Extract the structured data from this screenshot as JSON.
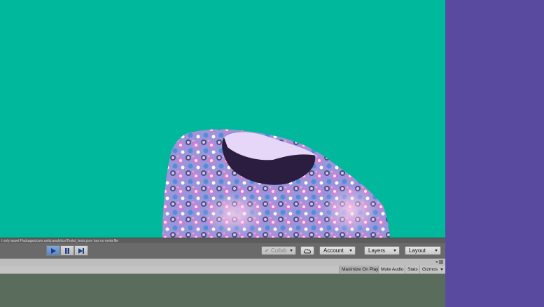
{
  "console": {
    "message": "t only asset Packages/com.unity.analytics/Tests/_tests.json has no meta file"
  },
  "toolbar": {
    "play_icon": "play-icon",
    "pause_icon": "pause-icon",
    "step_icon": "step-icon",
    "collab_label": "Collab",
    "account_label": "Account",
    "layers_label": "Layers",
    "layout_label": "Layout"
  },
  "game_options": {
    "maximize_on_play": "Maximize On Play",
    "mute_audio": "Mute Audio",
    "stats": "Stats",
    "gizmos": "Gizmos"
  },
  "colors": {
    "scene_background": "#00b89c",
    "side_panel": "#5a4a9f",
    "toolbar": "#6a6a6a",
    "play_active": "#5b86c0",
    "game_view": "#5a6d5c"
  }
}
